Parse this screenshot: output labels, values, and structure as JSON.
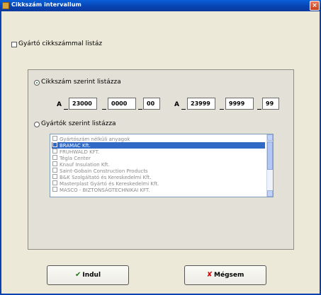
{
  "window": {
    "title": "Cikkszám intervallum",
    "close_glyph": "×"
  },
  "manufacturer_filter": {
    "label": "Gyártó cikkszámmal listáz",
    "checked": false
  },
  "mode_sku": {
    "label": "Cikkszám szerint listázza",
    "selected": true
  },
  "range_from": {
    "prefix": "A",
    "part1": "23000",
    "part2": "0000",
    "part3": "00"
  },
  "range_to": {
    "prefix": "A",
    "part1": "23999",
    "part2": "9999",
    "part3": "99"
  },
  "mode_manufacturer": {
    "label": "Gyártók szerint listázza",
    "selected": false
  },
  "manufacturers": [
    "Gyártószám nélküli anyagok",
    "BRAMAC Kft.",
    "FRUHWALD KFT.",
    "Tégla Center",
    "Knauf Insulation Kft.",
    "Saint-Gobain Construction Products",
    "B&K Szolgáltató és Kereskedelmi Kft.",
    "Masterplast Gyártó és Kereskedelmi Kft.",
    "MASCO - BIZTONSÁGTECHNIKAI KFT."
  ],
  "manufacturers_selected_index": 1,
  "buttons": {
    "start": {
      "label": "Indul",
      "icon": "check-icon",
      "glyph": "✔",
      "color": "#1c7a1c"
    },
    "cancel": {
      "label": "Mégsem",
      "icon": "cross-icon",
      "glyph": "✘",
      "color": "#cc1111"
    }
  }
}
